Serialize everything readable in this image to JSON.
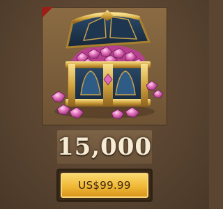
{
  "offer": {
    "amount": "15,000",
    "price_label": "US$99.99"
  },
  "icons": {
    "item": "treasure-chest-gems-icon",
    "badge": "corner-ribbon"
  },
  "colors": {
    "button_gold": "#f0b936",
    "ribbon_red": "#9b1f16",
    "gem_pink": "#e06bb8"
  }
}
